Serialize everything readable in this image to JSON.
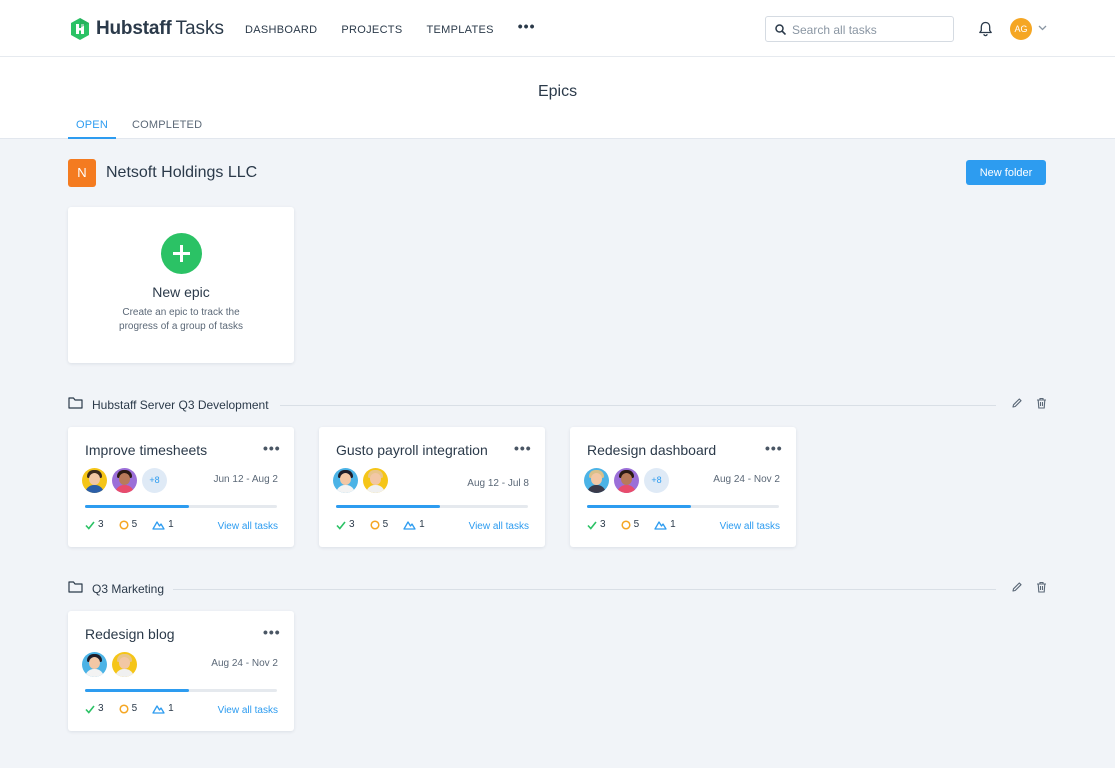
{
  "app": {
    "brand": "Hubstaff",
    "product": "Tasks"
  },
  "nav": {
    "dashboard": "DASHBOARD",
    "projects": "PROJECTS",
    "templates": "TEMPLATES",
    "more": "•••"
  },
  "search": {
    "placeholder": "Search all tasks"
  },
  "user": {
    "initials": "AG"
  },
  "page": {
    "title": "Epics"
  },
  "tabs": [
    {
      "label": "OPEN"
    },
    {
      "label": "COMPLETED"
    }
  ],
  "org": {
    "badge": "N",
    "name": "Netsoft Holdings LLC"
  },
  "new_folder": "New folder",
  "new_epic": {
    "title": "New epic",
    "description": "Create an epic to track the progress of a group of tasks"
  },
  "folders": [
    {
      "name": "Hubstaff Server Q3 Development",
      "epics": [
        {
          "title": "Improve timesheets",
          "dates": "Jun 12 - Aug 2",
          "more_count": "+8",
          "progress": 0.54,
          "done": "3",
          "open": "5",
          "blocked": "1",
          "view": "View all tasks"
        },
        {
          "title": "Gusto payroll integration",
          "dates": "Aug 12 - Jul 8",
          "progress": 0.54,
          "done": "3",
          "open": "5",
          "blocked": "1",
          "view": "View all tasks"
        },
        {
          "title": "Redesign dashboard",
          "dates": "Aug 24 - Nov 2",
          "more_count": "+8",
          "progress": 0.54,
          "done": "3",
          "open": "5",
          "blocked": "1",
          "view": "View all tasks"
        }
      ]
    },
    {
      "name": "Q3 Marketing",
      "epics": [
        {
          "title": "Redesign blog",
          "dates": "Aug 24 - Nov 2",
          "progress": 0.54,
          "done": "3",
          "open": "5",
          "blocked": "1",
          "view": "View all tasks"
        }
      ]
    }
  ],
  "colors": {
    "accent": "#2d9cf0",
    "green": "#2bc265",
    "orange": "#f47b20",
    "done": "#2bc265",
    "open": "#f5a623"
  }
}
